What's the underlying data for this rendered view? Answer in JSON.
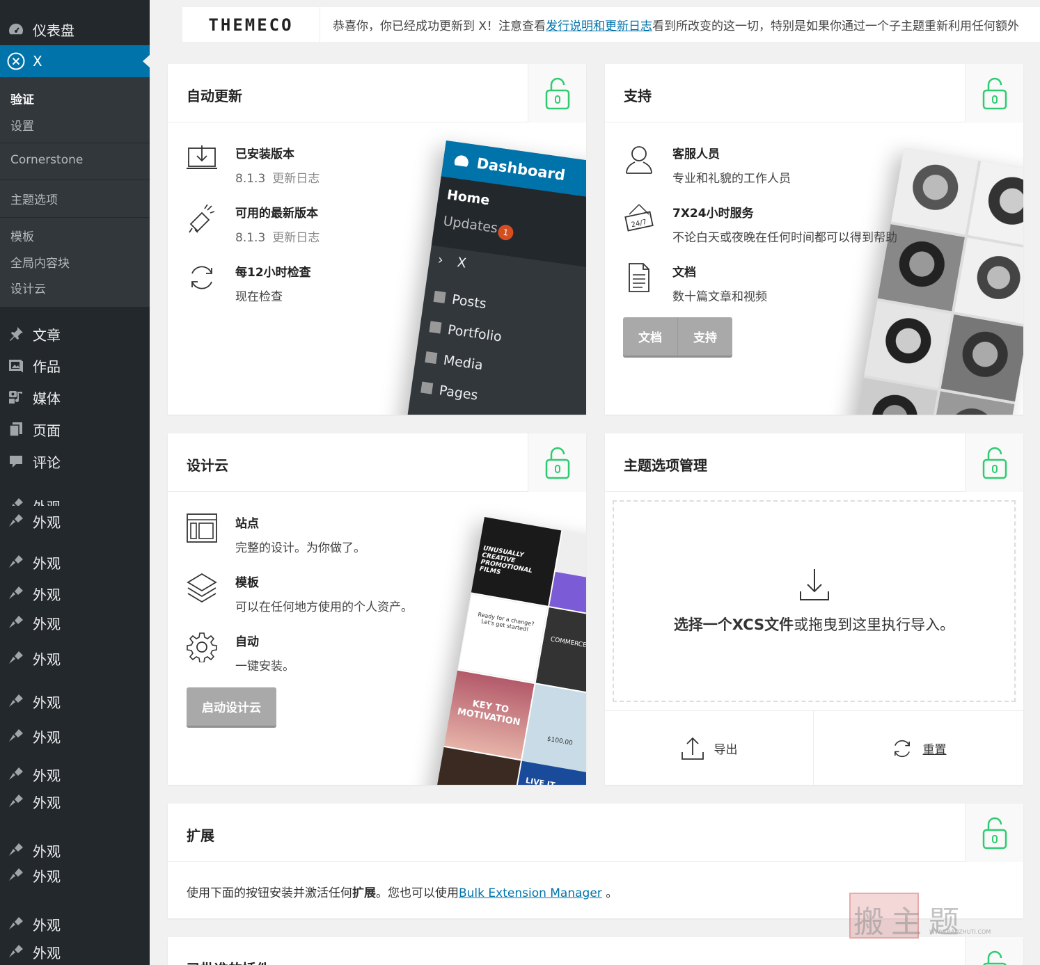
{
  "sidebar": {
    "top_items": [
      {
        "label": "仪表盘",
        "icon": "dashboard-icon"
      },
      {
        "label": "X",
        "icon": "x-circle-icon"
      }
    ],
    "submenu": [
      "验证",
      "设置",
      "Cornerstone",
      "主题选项",
      "模板",
      "全局内容块",
      "设计云"
    ],
    "items": [
      {
        "label": "文章",
        "icon": "pin-icon"
      },
      {
        "label": "作品",
        "icon": "portfolio-icon"
      },
      {
        "label": "媒体",
        "icon": "media-icon"
      },
      {
        "label": "页面",
        "icon": "pages-icon"
      },
      {
        "label": "评论",
        "icon": "comment-icon"
      }
    ],
    "appearance_label": "外观"
  },
  "notice": {
    "logo": "THEMECO",
    "text_before": "恭喜你，你已经成功更新到 X！注意查看",
    "link": "发行说明和更新日志",
    "text_after": "看到所改变的这一切，特别是如果你通过一个子主题重新利用任何额外"
  },
  "auto_update": {
    "title": "自动更新",
    "installed_heading": "已安装版本",
    "installed_version": "8.1.3",
    "installed_changelog": "更新日志",
    "latest_heading": "可用的最新版本",
    "latest_version": "8.1.3",
    "latest_changelog": "更新日志",
    "check_heading": "每12小时检查",
    "check_now": "现在检查",
    "art": {
      "dashboard": "Dashboard",
      "home": "Home",
      "updates": "Updates",
      "badge": "1",
      "x": "X",
      "posts": "Posts",
      "portfolio": "Portfolio",
      "media": "Media",
      "pages": "Pages"
    }
  },
  "support": {
    "title": "支持",
    "staff_heading": "客服人员",
    "staff_sub": "专业和礼貌的工作人员",
    "service_heading": "7X24小时服务",
    "service_sub": "不论白天或夜晚在任何时间都可以得到帮助",
    "sign_text": "24/7",
    "docs_heading": "文档",
    "docs_sub": "数十篇文章和视频",
    "btn_docs": "文档",
    "btn_support": "支持"
  },
  "design_cloud": {
    "title": "设计云",
    "site_heading": "站点",
    "site_sub": "完整的设计。为你做了。",
    "template_heading": "模板",
    "template_sub": "可以在任何地方使用的个人资产。",
    "auto_heading": "自动",
    "auto_sub": "一键安装。",
    "launch_button": "启动设计云",
    "art": {
      "t1": "UNUSUALLY CREATIVE PROMOTIONAL FILMS",
      "t2": "Ready for a change? Let's get started!",
      "t3": "KEY TO MOTIVATION",
      "t4": "COMMERCE",
      "t5": "$100.00",
      "t6": "LIVE IT"
    }
  },
  "theme_options": {
    "title": "主题选项管理",
    "drop_bold1": "选择一个XCS文件",
    "drop_mid": "或拖曳到这里执行导入。",
    "export": "导出",
    "reset": "重置"
  },
  "extensions": {
    "title": "扩展",
    "text_before": "使用下面的按钮安装并激活任何",
    "text_bold": "扩展",
    "text_mid": "。您也可以使用",
    "link": "Bulk Extension Manager",
    "text_after": " 。"
  },
  "approved": {
    "title": "已批准的插件"
  },
  "watermark": {
    "main": "搬主题",
    "url": "WWW.BANZHUTI.COM"
  },
  "colors": {
    "accent": "#0073aa",
    "sidebar": "#23282d",
    "submenu": "#32373c",
    "lock": "#2ecc71",
    "button": "#a9a9a9"
  }
}
